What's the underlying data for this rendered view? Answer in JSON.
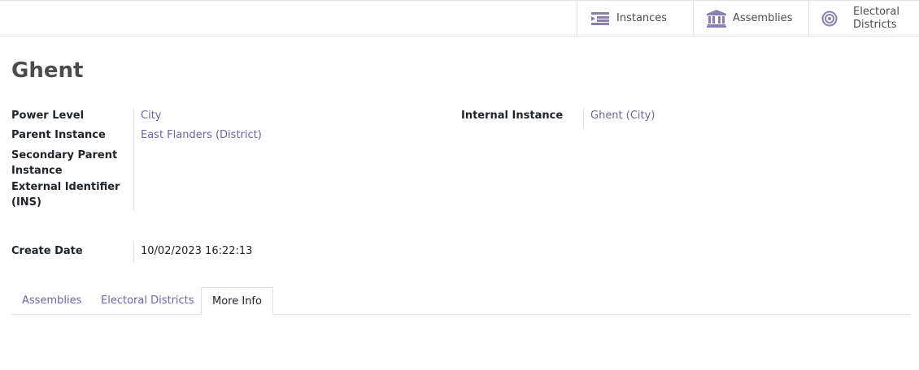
{
  "smart_buttons": {
    "instances": {
      "label": "Instances",
      "icon": "list-icon"
    },
    "assemblies": {
      "label": "Assemblies",
      "icon": "institution-icon"
    },
    "electoral_districts": {
      "label_line1": "Electoral",
      "label_line2": "Districts",
      "icon": "bullseye-icon"
    }
  },
  "record": {
    "title": "Ghent"
  },
  "fields": {
    "power_level": {
      "label": "Power Level",
      "value": "City"
    },
    "parent_instance": {
      "label": "Parent Instance",
      "value": "East Flanders (District)"
    },
    "secondary_parent_instance": {
      "label": "Secondary Parent Instance",
      "value": ""
    },
    "external_identifier": {
      "label": "External Identifier (INS)",
      "value": ""
    },
    "create_date": {
      "label": "Create Date",
      "value": "10/02/2023 16:22:13"
    },
    "internal_instance": {
      "label": "Internal Instance",
      "value": "Ghent (City)"
    }
  },
  "tabs": [
    {
      "label": "Assemblies"
    },
    {
      "label": "Electoral Districts"
    },
    {
      "label": "More Info",
      "active": true
    }
  ],
  "colors": {
    "link": "#71639e",
    "icon": "#8a7fb0",
    "border": "#dee2e6"
  }
}
